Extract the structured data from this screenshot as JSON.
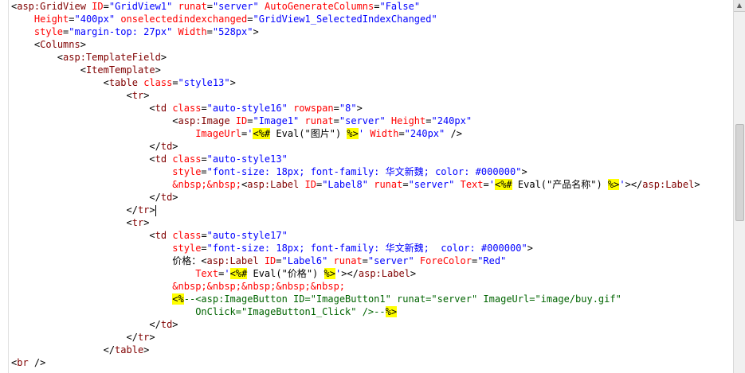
{
  "editor": {
    "lines": [
      {
        "indent": "",
        "tokens": [
          {
            "t": "text",
            "v": "<"
          },
          {
            "t": "tag",
            "v": "asp:GridView"
          },
          {
            "t": "text",
            "v": " "
          },
          {
            "t": "attr",
            "v": "ID"
          },
          {
            "t": "text",
            "v": "="
          },
          {
            "t": "val",
            "v": "\"GridView1\""
          },
          {
            "t": "text",
            "v": " "
          },
          {
            "t": "attr",
            "v": "runat"
          },
          {
            "t": "text",
            "v": "="
          },
          {
            "t": "val",
            "v": "\"server\""
          },
          {
            "t": "text",
            "v": " "
          },
          {
            "t": "attr",
            "v": "AutoGenerateColumns"
          },
          {
            "t": "text",
            "v": "="
          },
          {
            "t": "val",
            "v": "\"False\""
          }
        ]
      },
      {
        "indent": "    ",
        "tokens": [
          {
            "t": "attr",
            "v": "Height"
          },
          {
            "t": "text",
            "v": "="
          },
          {
            "t": "val",
            "v": "\"400px\""
          },
          {
            "t": "text",
            "v": " "
          },
          {
            "t": "attr",
            "v": "onselectedindexchanged"
          },
          {
            "t": "text",
            "v": "="
          },
          {
            "t": "val",
            "v": "\"GridView1_SelectedIndexChanged\""
          }
        ]
      },
      {
        "indent": "    ",
        "tokens": [
          {
            "t": "attr",
            "v": "style"
          },
          {
            "t": "text",
            "v": "="
          },
          {
            "t": "val",
            "v": "\"margin-top: 27px\""
          },
          {
            "t": "text",
            "v": " "
          },
          {
            "t": "attr",
            "v": "Width"
          },
          {
            "t": "text",
            "v": "="
          },
          {
            "t": "val",
            "v": "\"528px\""
          },
          {
            "t": "text",
            "v": ">"
          }
        ]
      },
      {
        "indent": "    ",
        "tokens": [
          {
            "t": "text",
            "v": "<"
          },
          {
            "t": "tag",
            "v": "Columns"
          },
          {
            "t": "text",
            "v": ">"
          }
        ]
      },
      {
        "indent": "        ",
        "tokens": [
          {
            "t": "text",
            "v": "<"
          },
          {
            "t": "tag",
            "v": "asp:TemplateField"
          },
          {
            "t": "text",
            "v": ">"
          }
        ]
      },
      {
        "indent": "            ",
        "tokens": [
          {
            "t": "text",
            "v": "<"
          },
          {
            "t": "tag",
            "v": "ItemTemplate"
          },
          {
            "t": "text",
            "v": ">"
          }
        ]
      },
      {
        "indent": "                ",
        "tokens": [
          {
            "t": "text",
            "v": "<"
          },
          {
            "t": "tag",
            "v": "table"
          },
          {
            "t": "text",
            "v": " "
          },
          {
            "t": "attr",
            "v": "class"
          },
          {
            "t": "text",
            "v": "="
          },
          {
            "t": "val",
            "v": "\"style13\""
          },
          {
            "t": "text",
            "v": ">"
          }
        ]
      },
      {
        "indent": "                    ",
        "tokens": [
          {
            "t": "text",
            "v": "<"
          },
          {
            "t": "tag",
            "v": "tr"
          },
          {
            "t": "text",
            "v": ">"
          }
        ]
      },
      {
        "indent": "                        ",
        "tokens": [
          {
            "t": "text",
            "v": "<"
          },
          {
            "t": "tag",
            "v": "td"
          },
          {
            "t": "text",
            "v": " "
          },
          {
            "t": "attr",
            "v": "class"
          },
          {
            "t": "text",
            "v": "="
          },
          {
            "t": "val",
            "v": "\"auto-style16\""
          },
          {
            "t": "text",
            "v": " "
          },
          {
            "t": "attr",
            "v": "rowspan"
          },
          {
            "t": "text",
            "v": "="
          },
          {
            "t": "val",
            "v": "\"8\""
          },
          {
            "t": "text",
            "v": ">"
          }
        ]
      },
      {
        "indent": "                            ",
        "tokens": [
          {
            "t": "text",
            "v": "<"
          },
          {
            "t": "tag",
            "v": "asp:Image"
          },
          {
            "t": "text",
            "v": " "
          },
          {
            "t": "attr",
            "v": "ID"
          },
          {
            "t": "text",
            "v": "="
          },
          {
            "t": "val",
            "v": "\"Image1\""
          },
          {
            "t": "text",
            "v": " "
          },
          {
            "t": "attr",
            "v": "runat"
          },
          {
            "t": "text",
            "v": "="
          },
          {
            "t": "val",
            "v": "\"server\""
          },
          {
            "t": "text",
            "v": " "
          },
          {
            "t": "attr",
            "v": "Height"
          },
          {
            "t": "text",
            "v": "="
          },
          {
            "t": "val",
            "v": "\"240px\""
          }
        ]
      },
      {
        "indent": "                                ",
        "tokens": [
          {
            "t": "attr",
            "v": "ImageUrl"
          },
          {
            "t": "text",
            "v": "="
          },
          {
            "t": "val",
            "v": "'"
          },
          {
            "t": "delim",
            "v": "<%#"
          },
          {
            "t": "text",
            "v": " Eval(\"图片\") "
          },
          {
            "t": "delim",
            "v": "%>"
          },
          {
            "t": "val",
            "v": "'"
          },
          {
            "t": "text",
            "v": " "
          },
          {
            "t": "attr",
            "v": "Width"
          },
          {
            "t": "text",
            "v": "="
          },
          {
            "t": "val",
            "v": "\"240px\""
          },
          {
            "t": "text",
            "v": " />"
          }
        ]
      },
      {
        "indent": "                        ",
        "tokens": [
          {
            "t": "text",
            "v": "</"
          },
          {
            "t": "tag",
            "v": "td"
          },
          {
            "t": "text",
            "v": ">"
          }
        ]
      },
      {
        "indent": "                        ",
        "tokens": [
          {
            "t": "text",
            "v": "<"
          },
          {
            "t": "tag",
            "v": "td"
          },
          {
            "t": "text",
            "v": " "
          },
          {
            "t": "attr",
            "v": "class"
          },
          {
            "t": "text",
            "v": "="
          },
          {
            "t": "val",
            "v": "\"auto-style13\""
          }
        ]
      },
      {
        "indent": "                            ",
        "tokens": [
          {
            "t": "attr",
            "v": "style"
          },
          {
            "t": "text",
            "v": "="
          },
          {
            "t": "val",
            "v": "\"font-size: 18px; font-family: 华文新魏; color: #000000\""
          },
          {
            "t": "text",
            "v": ">"
          }
        ]
      },
      {
        "indent": "                            ",
        "tokens": [
          {
            "t": "entity",
            "v": "&nbsp;&nbsp;"
          },
          {
            "t": "text",
            "v": "<"
          },
          {
            "t": "tag",
            "v": "asp:Label"
          },
          {
            "t": "text",
            "v": " "
          },
          {
            "t": "attr",
            "v": "ID"
          },
          {
            "t": "text",
            "v": "="
          },
          {
            "t": "val",
            "v": "\"Label8\""
          },
          {
            "t": "text",
            "v": " "
          },
          {
            "t": "attr",
            "v": "runat"
          },
          {
            "t": "text",
            "v": "="
          },
          {
            "t": "val",
            "v": "\"server\""
          },
          {
            "t": "text",
            "v": " "
          },
          {
            "t": "attr",
            "v": "Text"
          },
          {
            "t": "text",
            "v": "="
          },
          {
            "t": "val",
            "v": "'"
          },
          {
            "t": "delim",
            "v": "<%#"
          },
          {
            "t": "text",
            "v": " Eval(\"产品名称\") "
          },
          {
            "t": "delim",
            "v": "%>"
          },
          {
            "t": "val",
            "v": "'"
          },
          {
            "t": "text",
            "v": "></"
          },
          {
            "t": "tag",
            "v": "asp:Label"
          },
          {
            "t": "text",
            "v": ">"
          }
        ]
      },
      {
        "indent": "                        ",
        "tokens": [
          {
            "t": "text",
            "v": "</"
          },
          {
            "t": "tag",
            "v": "td"
          },
          {
            "t": "text",
            "v": ">"
          }
        ]
      },
      {
        "indent": "                    ",
        "caret": true,
        "tokens": [
          {
            "t": "text",
            "v": "</"
          },
          {
            "t": "tag",
            "v": "tr"
          },
          {
            "t": "text",
            "v": ">"
          }
        ]
      },
      {
        "indent": "                    ",
        "tokens": [
          {
            "t": "text",
            "v": "<"
          },
          {
            "t": "tag",
            "v": "tr"
          },
          {
            "t": "text",
            "v": ">"
          }
        ]
      },
      {
        "indent": "                        ",
        "tokens": [
          {
            "t": "text",
            "v": "<"
          },
          {
            "t": "tag",
            "v": "td"
          },
          {
            "t": "text",
            "v": " "
          },
          {
            "t": "attr",
            "v": "class"
          },
          {
            "t": "text",
            "v": "="
          },
          {
            "t": "val",
            "v": "\"auto-style17\""
          }
        ]
      },
      {
        "indent": "                            ",
        "tokens": [
          {
            "t": "attr",
            "v": "style"
          },
          {
            "t": "text",
            "v": "="
          },
          {
            "t": "val",
            "v": "\"font-size: 18px; font-family: 华文新魏;  color: #000000\""
          },
          {
            "t": "text",
            "v": ">"
          }
        ]
      },
      {
        "indent": "                            ",
        "tokens": [
          {
            "t": "text",
            "v": "价格："
          },
          {
            "t": "text",
            "v": "<"
          },
          {
            "t": "tag",
            "v": "asp:Label"
          },
          {
            "t": "text",
            "v": " "
          },
          {
            "t": "attr",
            "v": "ID"
          },
          {
            "t": "text",
            "v": "="
          },
          {
            "t": "val",
            "v": "\"Label6\""
          },
          {
            "t": "text",
            "v": " "
          },
          {
            "t": "attr",
            "v": "runat"
          },
          {
            "t": "text",
            "v": "="
          },
          {
            "t": "val",
            "v": "\"server\""
          },
          {
            "t": "text",
            "v": " "
          },
          {
            "t": "attr",
            "v": "ForeColor"
          },
          {
            "t": "text",
            "v": "="
          },
          {
            "t": "val",
            "v": "\"Red\""
          }
        ]
      },
      {
        "indent": "                                ",
        "tokens": [
          {
            "t": "attr",
            "v": "Text"
          },
          {
            "t": "text",
            "v": "="
          },
          {
            "t": "val",
            "v": "'"
          },
          {
            "t": "delim",
            "v": "<%#"
          },
          {
            "t": "text",
            "v": " Eval(\"价格\") "
          },
          {
            "t": "delim",
            "v": "%>"
          },
          {
            "t": "val",
            "v": "'"
          },
          {
            "t": "text",
            "v": "></"
          },
          {
            "t": "tag",
            "v": "asp:Label"
          },
          {
            "t": "text",
            "v": ">"
          }
        ]
      },
      {
        "indent": "                            ",
        "tokens": [
          {
            "t": "entity",
            "v": "&nbsp;&nbsp;&nbsp;&nbsp;&nbsp;"
          }
        ]
      },
      {
        "indent": "                            ",
        "tokens": [
          {
            "t": "delim",
            "v": "<%"
          },
          {
            "t": "comment",
            "v": "--<asp:ImageButton ID=\"ImageButton1\" runat=\"server\" ImageUrl=\"image/buy.gif\""
          }
        ]
      },
      {
        "indent": "                                ",
        "tokens": [
          {
            "t": "comment",
            "v": "OnClick=\"ImageButton1_Click\" />--"
          },
          {
            "t": "delim",
            "v": "%>"
          }
        ]
      },
      {
        "indent": "                        ",
        "tokens": [
          {
            "t": "text",
            "v": "</"
          },
          {
            "t": "tag",
            "v": "td"
          },
          {
            "t": "text",
            "v": ">"
          }
        ]
      },
      {
        "indent": "                    ",
        "tokens": [
          {
            "t": "text",
            "v": "</"
          },
          {
            "t": "tag",
            "v": "tr"
          },
          {
            "t": "text",
            "v": ">"
          }
        ]
      },
      {
        "indent": "                ",
        "tokens": [
          {
            "t": "text",
            "v": "</"
          },
          {
            "t": "tag",
            "v": "table"
          },
          {
            "t": "text",
            "v": ">"
          }
        ]
      },
      {
        "indent": "",
        "tokens": [
          {
            "t": "text",
            "v": "<"
          },
          {
            "t": "tag",
            "v": "br"
          },
          {
            "t": "text",
            "v": " />"
          }
        ]
      }
    ]
  },
  "scrollbar": {
    "up_icon": "▲",
    "down_icon": "▼"
  },
  "colors": {
    "tag": "#800000",
    "attr": "#ff0000",
    "val": "#0000ff",
    "delim_bg": "#ffff00",
    "comment": "#006400",
    "entity": "#ff0000"
  }
}
